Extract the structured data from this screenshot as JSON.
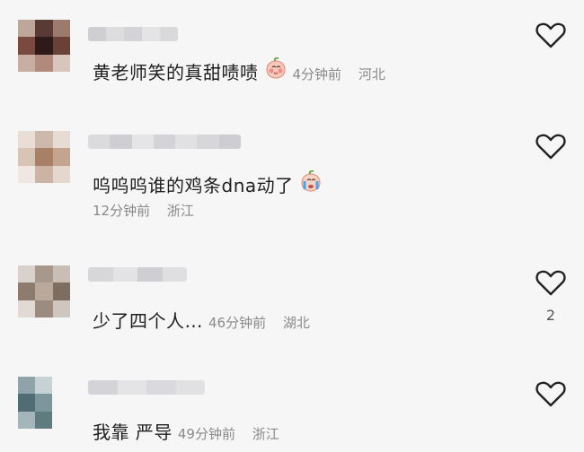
{
  "comments": [
    {
      "text": "黄老师笑的真甜啧啧",
      "emoji_icon": "blush-peach-emoji",
      "time": "4分钟前",
      "location": "河北",
      "likes": ""
    },
    {
      "text": "呜呜呜谁的鸡条dna动了",
      "emoji_icon": "crying-peach-emoji",
      "time": "12分钟前",
      "location": "浙江",
      "likes": ""
    },
    {
      "text": "少了四个人…",
      "emoji_icon": "",
      "time": "46分钟前",
      "location": "湖北",
      "likes": "2"
    },
    {
      "text": "我靠 严导",
      "emoji_icon": "",
      "time": "49分钟前",
      "location": "浙江",
      "likes": ""
    }
  ],
  "colors": {
    "background": "#f6f6f6",
    "meta_text": "#8a8a8a",
    "heart_stroke": "#222222"
  }
}
